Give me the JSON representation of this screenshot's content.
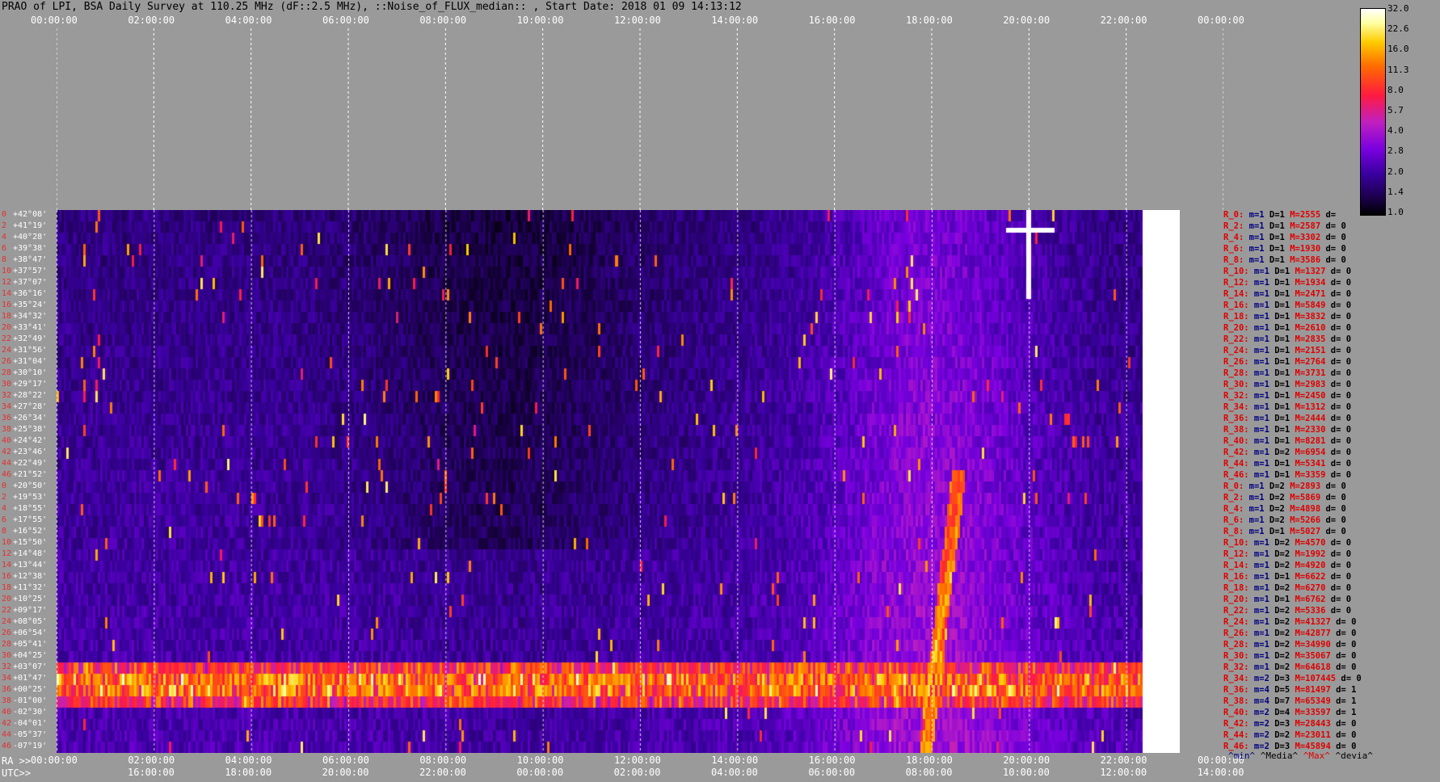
{
  "title": "PRAO of LPI, BSA Daily Survey at 110.25 MHz (dF::2.5 MHz), ::Noise_of_FLUX_median:: , Start Date: 2018 01 09 14:13:12",
  "top_axis": [
    "00:00:00",
    "02:00:00",
    "04:00:00",
    "06:00:00",
    "08:00:00",
    "10:00:00",
    "12:00:00",
    "14:00:00",
    "16:00:00",
    "18:00:00",
    "20:00:00",
    "22:00:00",
    "00:00:00"
  ],
  "ra_label": "RA >>",
  "utc_label": "UTC>>",
  "ra_axis": [
    "00:00:00",
    "02:00:00",
    "04:00:00",
    "06:00:00",
    "08:00:00",
    "10:00:00",
    "12:00:00",
    "14:00:00",
    "16:00:00",
    "18:00:00",
    "20:00:00",
    "22:00:00",
    "00:00:00"
  ],
  "utc_axis": [
    "16:00:00",
    "18:00:00",
    "20:00:00",
    "22:00:00",
    "00:00:00",
    "02:00:00",
    "04:00:00",
    "06:00:00",
    "08:00:00",
    "10:00:00",
    "12:00:00",
    "14:00:00"
  ],
  "colorbar": {
    "ticks": [
      "32.0",
      "22.6",
      "16.0",
      "11.3",
      "8.0",
      "5.7",
      "4.0",
      "2.8",
      "2.0",
      "1.4",
      "1.0"
    ],
    "colors": [
      "#000000",
      "#3a00a0",
      "#7a00e0",
      "#c020c0",
      "#ff1a40",
      "#ff6a00",
      "#ffcc00",
      "#ffffff"
    ]
  },
  "declinations": [
    {
      "i": "0",
      "d": "+42°08'"
    },
    {
      "i": "2",
      "d": "+41°19'"
    },
    {
      "i": "4",
      "d": "+40°28'"
    },
    {
      "i": "6",
      "d": "+39°38'"
    },
    {
      "i": "8",
      "d": "+38°47'"
    },
    {
      "i": "10",
      "d": "+37°57'"
    },
    {
      "i": "12",
      "d": "+37°07'"
    },
    {
      "i": "14",
      "d": "+36°16'"
    },
    {
      "i": "16",
      "d": "+35°24'"
    },
    {
      "i": "18",
      "d": "+34°32'"
    },
    {
      "i": "20",
      "d": "+33°41'"
    },
    {
      "i": "22",
      "d": "+32°49'"
    },
    {
      "i": "24",
      "d": "+31°56'"
    },
    {
      "i": "26",
      "d": "+31°04'"
    },
    {
      "i": "28",
      "d": "+30°10'"
    },
    {
      "i": "30",
      "d": "+29°17'"
    },
    {
      "i": "32",
      "d": "+28°22'"
    },
    {
      "i": "34",
      "d": "+27°28'"
    },
    {
      "i": "36",
      "d": "+26°34'"
    },
    {
      "i": "38",
      "d": "+25°38'"
    },
    {
      "i": "40",
      "d": "+24°42'"
    },
    {
      "i": "42",
      "d": "+23°46'"
    },
    {
      "i": "44",
      "d": "+22°49'"
    },
    {
      "i": "46",
      "d": "+21°52'"
    },
    {
      "i": "0",
      "d": "+20°50'"
    },
    {
      "i": "2",
      "d": "+19°53'"
    },
    {
      "i": "4",
      "d": "+18°55'"
    },
    {
      "i": "6",
      "d": "+17°55'"
    },
    {
      "i": "8",
      "d": "+16°52'"
    },
    {
      "i": "10",
      "d": "+15°50'"
    },
    {
      "i": "12",
      "d": "+14°48'"
    },
    {
      "i": "14",
      "d": "+13°44'"
    },
    {
      "i": "16",
      "d": "+12°38'"
    },
    {
      "i": "18",
      "d": "+11°32'"
    },
    {
      "i": "20",
      "d": "+10°25'"
    },
    {
      "i": "22",
      "d": "+09°17'"
    },
    {
      "i": "24",
      "d": "+08°05'"
    },
    {
      "i": "26",
      "d": "+06°54'"
    },
    {
      "i": "28",
      "d": "+05°41'"
    },
    {
      "i": "30",
      "d": "+04°25'"
    },
    {
      "i": "32",
      "d": "+03°07'"
    },
    {
      "i": "34",
      "d": "+01°47'"
    },
    {
      "i": "36",
      "d": "+00°25'"
    },
    {
      "i": "38",
      "d": "-01°00'"
    },
    {
      "i": "40",
      "d": "-02°30'"
    },
    {
      "i": "42",
      "d": "-04°01'"
    },
    {
      "i": "44",
      "d": "-05°37'"
    },
    {
      "i": "46",
      "d": "-07°19'"
    }
  ],
  "right_rows": [
    {
      "r": "R_0:",
      "m": "m=1",
      "D": "D=1",
      "M": "M=2555",
      "d": "d="
    },
    {
      "r": "R_2:",
      "m": "m=1",
      "D": "D=1",
      "M": "M=2587",
      "d": "d= 0"
    },
    {
      "r": "R_4:",
      "m": "m=1",
      "D": "D=1",
      "M": "M=3302",
      "d": "d= 0"
    },
    {
      "r": "R_6:",
      "m": "m=1",
      "D": "D=1",
      "M": "M=1930",
      "d": "d= 0"
    },
    {
      "r": "R_8:",
      "m": "m=1",
      "D": "D=1",
      "M": "M=3586",
      "d": "d= 0"
    },
    {
      "r": "R_10:",
      "m": "m=1",
      "D": "D=1",
      "M": "M=1327",
      "d": "d= 0"
    },
    {
      "r": "R_12:",
      "m": "m=1",
      "D": "D=1",
      "M": "M=1934",
      "d": "d= 0"
    },
    {
      "r": "R_14:",
      "m": "m=1",
      "D": "D=1",
      "M": "M=2471",
      "d": "d= 0"
    },
    {
      "r": "R_16:",
      "m": "m=1",
      "D": "D=1",
      "M": "M=5849",
      "d": "d= 0"
    },
    {
      "r": "R_18:",
      "m": "m=1",
      "D": "D=1",
      "M": "M=3832",
      "d": "d= 0"
    },
    {
      "r": "R_20:",
      "m": "m=1",
      "D": "D=1",
      "M": "M=2610",
      "d": "d= 0"
    },
    {
      "r": "R_22:",
      "m": "m=1",
      "D": "D=1",
      "M": "M=2835",
      "d": "d= 0"
    },
    {
      "r": "R_24:",
      "m": "m=1",
      "D": "D=1",
      "M": "M=2151",
      "d": "d= 0"
    },
    {
      "r": "R_26:",
      "m": "m=1",
      "D": "D=1",
      "M": "M=2764",
      "d": "d= 0"
    },
    {
      "r": "R_28:",
      "m": "m=1",
      "D": "D=1",
      "M": "M=3731",
      "d": "d= 0"
    },
    {
      "r": "R_30:",
      "m": "m=1",
      "D": "D=1",
      "M": "M=2983",
      "d": "d= 0"
    },
    {
      "r": "R_32:",
      "m": "m=1",
      "D": "D=1",
      "M": "M=2450",
      "d": "d= 0"
    },
    {
      "r": "R_34:",
      "m": "m=1",
      "D": "D=1",
      "M": "M=1312",
      "d": "d= 0"
    },
    {
      "r": "R_36:",
      "m": "m=1",
      "D": "D=1",
      "M": "M=2444",
      "d": "d= 0"
    },
    {
      "r": "R_38:",
      "m": "m=1",
      "D": "D=1",
      "M": "M=2330",
      "d": "d= 0"
    },
    {
      "r": "R_40:",
      "m": "m=1",
      "D": "D=1",
      "M": "M=8281",
      "d": "d= 0"
    },
    {
      "r": "R_42:",
      "m": "m=1",
      "D": "D=2",
      "M": "M=6954",
      "d": "d= 0"
    },
    {
      "r": "R_44:",
      "m": "m=1",
      "D": "D=1",
      "M": "M=5341",
      "d": "d= 0"
    },
    {
      "r": "R_46:",
      "m": "m=1",
      "D": "D=1",
      "M": "M=3359",
      "d": "d= 0"
    },
    {
      "r": "R_0:",
      "m": "m=1",
      "D": "D=2",
      "M": "M=2893",
      "d": "d= 0"
    },
    {
      "r": "R_2:",
      "m": "m=1",
      "D": "D=2",
      "M": "M=5869",
      "d": "d= 0"
    },
    {
      "r": "R_4:",
      "m": "m=1",
      "D": "D=2",
      "M": "M=4898",
      "d": "d= 0"
    },
    {
      "r": "R_6:",
      "m": "m=1",
      "D": "D=2",
      "M": "M=5266",
      "d": "d= 0"
    },
    {
      "r": "R_8:",
      "m": "m=1",
      "D": "D=1",
      "M": "M=5027",
      "d": "d= 0"
    },
    {
      "r": "R_10:",
      "m": "m=1",
      "D": "D=2",
      "M": "M=4570",
      "d": "d= 0"
    },
    {
      "r": "R_12:",
      "m": "m=1",
      "D": "D=2",
      "M": "M=1992",
      "d": "d= 0"
    },
    {
      "r": "R_14:",
      "m": "m=1",
      "D": "D=2",
      "M": "M=4920",
      "d": "d= 0"
    },
    {
      "r": "R_16:",
      "m": "m=1",
      "D": "D=1",
      "M": "M=6622",
      "d": "d= 0"
    },
    {
      "r": "R_18:",
      "m": "m=1",
      "D": "D=2",
      "M": "M=6270",
      "d": "d= 0"
    },
    {
      "r": "R_20:",
      "m": "m=1",
      "D": "D=1",
      "M": "M=6762",
      "d": "d= 0"
    },
    {
      "r": "R_22:",
      "m": "m=1",
      "D": "D=2",
      "M": "M=5336",
      "d": "d= 0"
    },
    {
      "r": "R_24:",
      "m": "m=1",
      "D": "D=2",
      "M": "M=41327",
      "d": "d= 0"
    },
    {
      "r": "R_26:",
      "m": "m=1",
      "D": "D=2",
      "M": "M=42877",
      "d": "d= 0"
    },
    {
      "r": "R_28:",
      "m": "m=1",
      "D": "D=2",
      "M": "M=34990",
      "d": "d= 0"
    },
    {
      "r": "R_30:",
      "m": "m=1",
      "D": "D=2",
      "M": "M=35067",
      "d": "d= 0"
    },
    {
      "r": "R_32:",
      "m": "m=1",
      "D": "D=2",
      "M": "M=64618",
      "d": "d= 0"
    },
    {
      "r": "R_34:",
      "m": "m=2",
      "D": "D=3",
      "M": "M=107445",
      "d": "d= 0"
    },
    {
      "r": "R_36:",
      "m": "m=4",
      "D": "D=5",
      "M": "M=81497",
      "d": "d= 1"
    },
    {
      "r": "R_38:",
      "m": "m=4",
      "D": "D=7",
      "M": "M=65349",
      "d": "d= 1"
    },
    {
      "r": "R_40:",
      "m": "m=2",
      "D": "D=4",
      "M": "M=33597",
      "d": "d= 1"
    },
    {
      "r": "R_42:",
      "m": "m=2",
      "D": "D=3",
      "M": "M=28443",
      "d": "d= 0"
    },
    {
      "r": "R_44:",
      "m": "m=2",
      "D": "D=2",
      "M": "M=23011",
      "d": "d= 0"
    },
    {
      "r": "R_46:",
      "m": "m=2",
      "D": "D=3",
      "M": "M=45894",
      "d": "d= 0"
    }
  ],
  "footer_legend": {
    "min": "^min^",
    "median": "^Media^",
    "max": "^Max^",
    "dev": "^devia^"
  },
  "chart_data": {
    "type": "heatmap",
    "title": "PRAO of LPI, BSA Daily Survey at 110.25 MHz (dF::2.5 MHz), ::Noise_of_FLUX_median:: , Start Date: 2018 01 09 14:13:12",
    "x_ticks_ra": [
      "00:00:00",
      "02:00:00",
      "04:00:00",
      "06:00:00",
      "08:00:00",
      "10:00:00",
      "12:00:00",
      "14:00:00",
      "16:00:00",
      "18:00:00",
      "20:00:00",
      "22:00:00",
      "00:00:00"
    ],
    "x_ticks_utc": [
      "16:00:00",
      "18:00:00",
      "20:00:00",
      "22:00:00",
      "00:00:00",
      "02:00:00",
      "04:00:00",
      "06:00:00",
      "08:00:00",
      "10:00:00",
      "12:00:00",
      "14:00:00"
    ],
    "y_ticks": [
      "+42°08'",
      "-07°19'"
    ],
    "color_scale": {
      "min": 1.0,
      "max": 32.0,
      "log": true,
      "ticks": [
        1.0,
        1.4,
        2.0,
        2.8,
        4.0,
        5.7,
        8.0,
        11.3,
        16.0,
        22.6,
        32.0
      ]
    }
  }
}
